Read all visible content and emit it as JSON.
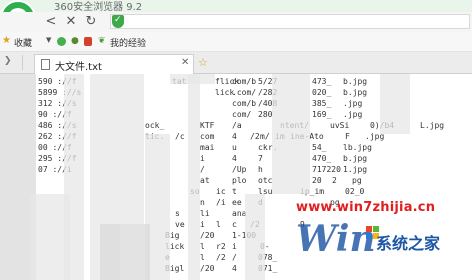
{
  "window": {
    "title": "360安全浏览器 9.2"
  },
  "navbar": {
    "back_label": "<",
    "close_label": "✕",
    "refresh_label": "↻",
    "home_label": "⌂",
    "address": ""
  },
  "bookmarks": {
    "items": [
      {
        "label": "收藏",
        "icon": "star-icon"
      },
      {
        "label": "我的经验",
        "icon": "leaf-icon"
      }
    ]
  },
  "tabs": {
    "active": {
      "label": "大文件.txt",
      "icon": "document-icon",
      "close": "✕"
    }
  },
  "content": {
    "lines": [
      "590  ://f  ",
      "5899 ://s  ",
      "312  ://s  ",
      "90   ://f  ",
      "486  ://s  ",
      "262  ://f  ",
      "00   ://f  ",
      "295  ://f  ",
      "07   ://i  "
    ],
    "segments": {
      "row0": [
        "tat",
        "flick",
        "com/b",
        "5/27",
        "473_",
        "b.jpg"
      ],
      "row1": [
        "lick",
        ".com/",
        "/282",
        "020_",
        "b.jpg"
      ],
      "row2": [
        "com/b",
        "/408",
        "385_",
        ".jpg"
      ],
      "row3": [
        "com/",
        "280",
        "169_",
        ".jpg"
      ],
      "row4": [
        "ock_",
        "KTF",
        "/a",
        "ntent/",
        "uvSi",
        "0)/b4",
        "L.jpg"
      ],
      "row5": [
        "tic.",
        "/c",
        "com",
        "4",
        "/2",
        "m/",
        "im",
        "ine-Ato",
        "F",
        ".jpg"
      ],
      "row6": [
        "mai",
        "u",
        "ck",
        "r.",
        "54_",
        "lb.jpg"
      ],
      "row7": [
        "i",
        "4",
        "7",
        "470_",
        "b.jpg"
      ],
      "row8": [
        "/",
        "/Up",
        "h",
        "717220",
        "1.jpg"
      ],
      "row9": [
        "at",
        "plo",
        "otc",
        "20",
        "2",
        "pg"
      ],
      "row10": [
        "so",
        "ic",
        "t",
        "lsu",
        "ip_im",
        "02_0"
      ],
      "row11": [
        "",
        "n",
        "/i",
        "ee",
        "d",
        "pg"
      ],
      "row12": [
        "",
        "s",
        "li",
        "ana"
      ],
      "row13": [
        "",
        "ve",
        "i",
        "l",
        "c",
        "/2",
        "9"
      ],
      "row14": [
        "",
        "Big",
        "/20",
        "1-100"
      ],
      "row15": [
        "",
        "lick",
        "l",
        "r2",
        "i",
        "0-"
      ],
      "row16": [
        "",
        "e",
        "l",
        "/2",
        "/",
        "078_"
      ],
      "row17": [
        "",
        "Bigl",
        "/20",
        "4",
        "071_"
      ]
    }
  },
  "watermark": {
    "url": "www.win7zhijia.cn",
    "brand_latin": "Win",
    "brand_cn": "系统之家"
  }
}
